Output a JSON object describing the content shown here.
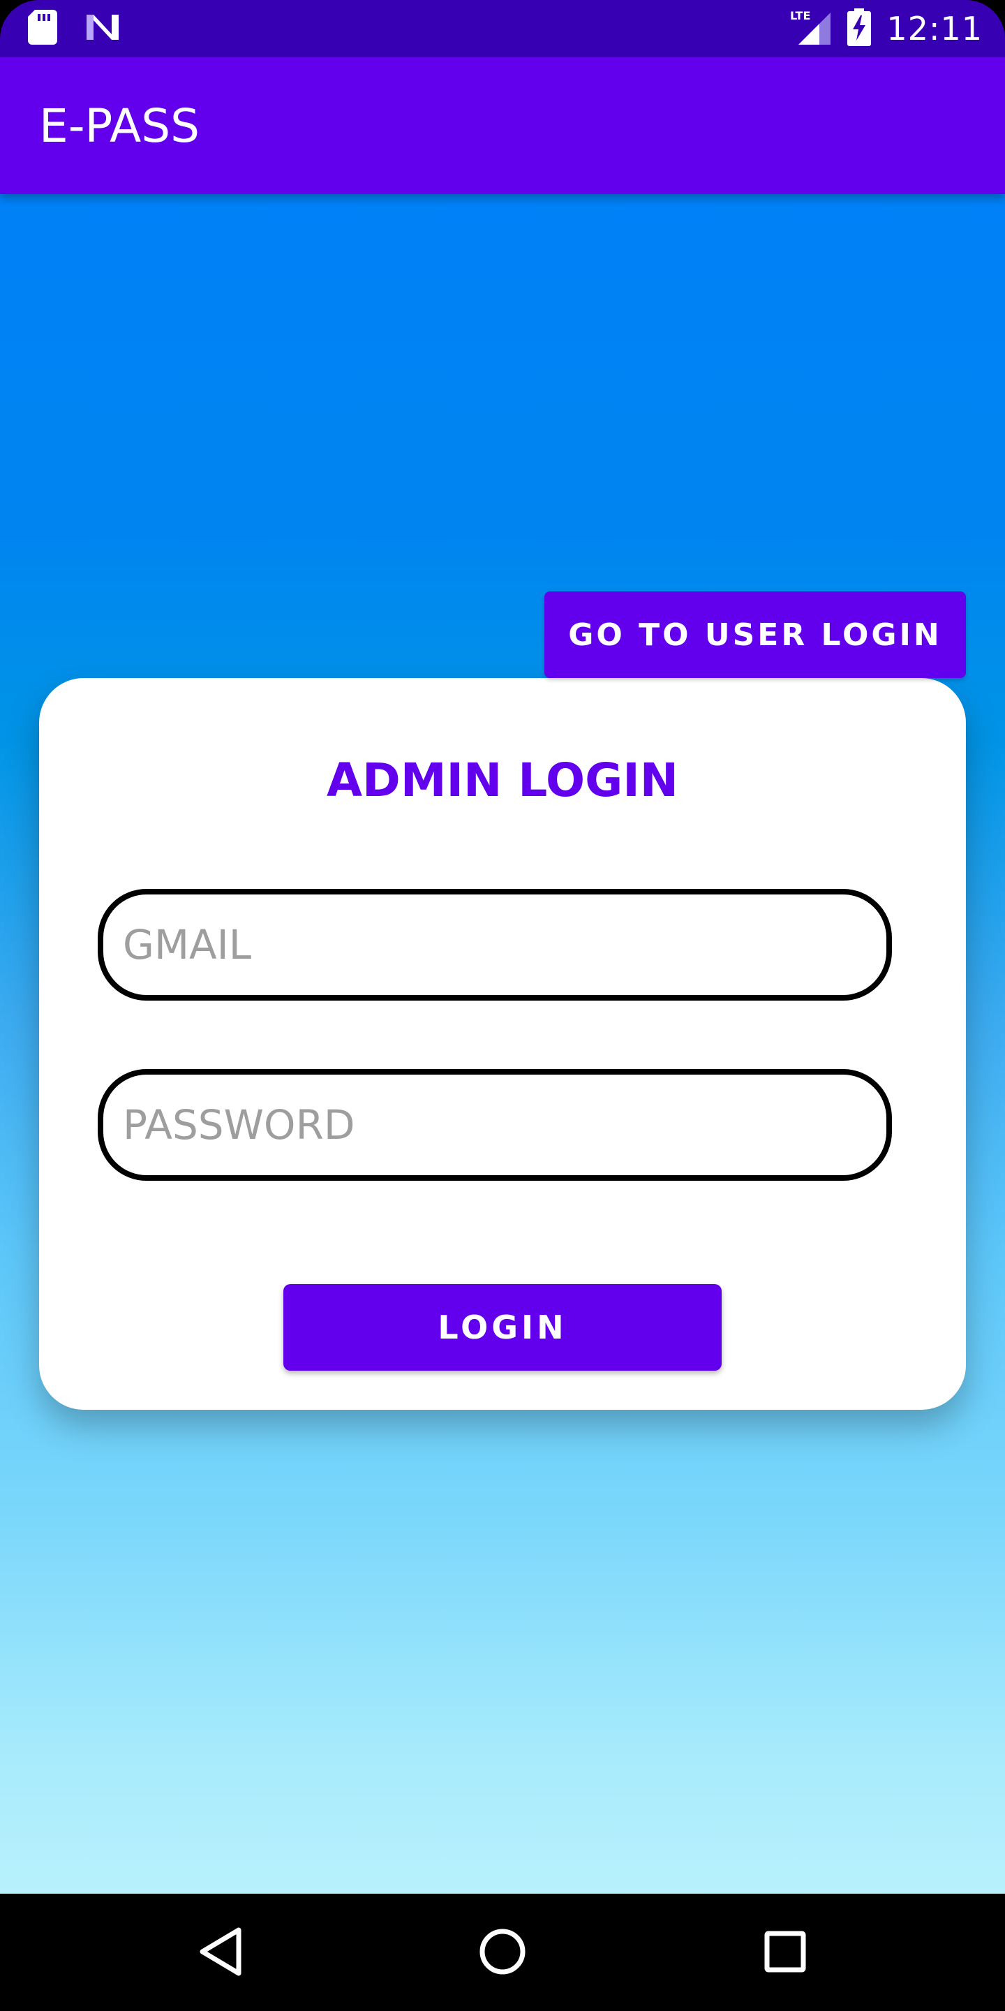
{
  "status_bar": {
    "time": "12:11",
    "network": "LTE",
    "icons": [
      "sd-card-icon",
      "notification-n-icon",
      "lte-signal-icon",
      "battery-charging-icon"
    ]
  },
  "app_bar": {
    "title": "E-PASS"
  },
  "main": {
    "go_user_login_label": "GO TO USER LOGIN",
    "card": {
      "title": "ADMIN LOGIN",
      "email_placeholder": "GMAIL",
      "password_placeholder": "PASSWORD",
      "login_label": "LOGIN"
    }
  },
  "nav_bar": {
    "icons": [
      "back-icon",
      "home-icon",
      "recents-icon"
    ]
  },
  "colors": {
    "primary": "#6200EE",
    "primary_dark": "#3700B3",
    "gradient_top": "#0081F7",
    "gradient_bottom": "#B8F1FD"
  }
}
